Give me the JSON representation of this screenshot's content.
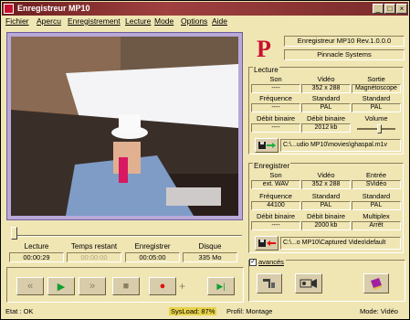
{
  "window": {
    "title": "Enregistreur MP10",
    "buttons": [
      "_",
      "□",
      "×"
    ]
  },
  "menu": [
    "Fichier",
    "Apercu",
    "Enregistrement",
    "Lecture",
    "Mode",
    "Options",
    "Aide"
  ],
  "info": {
    "product": "Enregistreur MP10 Rev.1.0.0.0",
    "vendor": "Pinnacle Systems",
    "logo_letter": "P"
  },
  "lecture": {
    "title": "Lecture",
    "headers": [
      "Son",
      "Vidéo",
      "Sortie"
    ],
    "row1": [
      "----",
      "352 x 288",
      "Magnétoscope"
    ],
    "labels2": [
      "Fréquence",
      "Standard",
      "Standard"
    ],
    "row2": [
      "----",
      "PAL",
      "PAL"
    ],
    "labels3": [
      "Débit binaire",
      "Débit binaire",
      "Volume"
    ],
    "row3": [
      "----",
      "2012 kb"
    ],
    "path": "C:\\...udio MP10\\movies\\ghaspal.m1v"
  },
  "enregistrer": {
    "title": "Enregistrer",
    "headers": [
      "Son",
      "Vidéo",
      "Entrée"
    ],
    "row1": [
      "ext. WAV",
      "352 x 288",
      "SVidéo"
    ],
    "labels2": [
      "Fréquence",
      "Standard",
      "Standard"
    ],
    "row2": [
      "44100",
      "PAL",
      "PAL"
    ],
    "labels3": [
      "Débit binaire",
      "Débit binaire",
      "Multiplex"
    ],
    "row3": [
      "----",
      "2000 kb",
      "Arrêt"
    ],
    "path": "C:\\...o MP10\\Captured Video\\default"
  },
  "stats": {
    "labels": [
      "Lecture",
      "Temps restant",
      "Enregistrer",
      "Disque"
    ],
    "values": [
      "00:00:29",
      "00:00:00",
      "00:05:00",
      "335 Mo"
    ]
  },
  "transport": [
    "«",
    "▶",
    "»",
    "■",
    "●",
    "+",
    "▶|"
  ],
  "advanced": {
    "label": "avancés",
    "checked": true
  },
  "status": {
    "state": "Etat : OK",
    "sysload": "SysLoad: 87%",
    "profile": "Profil: Montage",
    "mode": "Mode: Vidéo"
  },
  "colors": {
    "titlebar": "#7a2a2a",
    "window": "#f0e6b4",
    "video_border": "#b8a9d8",
    "logo": "#c8102e"
  }
}
